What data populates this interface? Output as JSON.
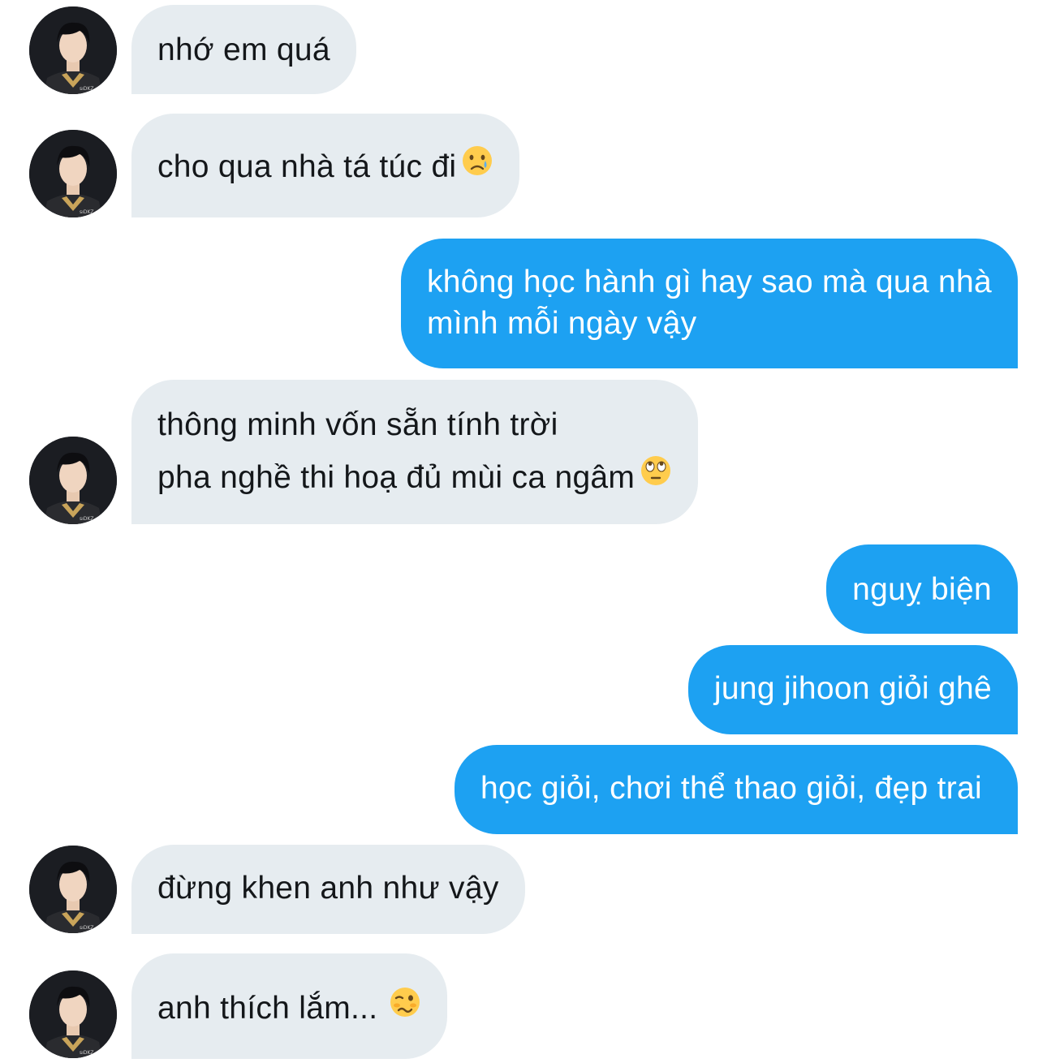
{
  "conversation": {
    "contact_avatar_label": "sıDKZ",
    "messages": [
      {
        "from": "them",
        "lines": [
          "nhớ em quá"
        ]
      },
      {
        "from": "them",
        "lines": [
          "cho qua nhà tá túc đi"
        ],
        "emoji": "crying-face"
      },
      {
        "from": "me",
        "lines": [
          "không học hành gì hay sao mà qua nhà",
          "mình mỗi ngày vậy"
        ]
      },
      {
        "from": "them",
        "lines": [
          "thông minh vốn sẵn tính trời",
          "pha nghề thi hoạ đủ mùi ca ngâm"
        ],
        "emoji": "eye-roll-face"
      },
      {
        "from": "me",
        "lines": [
          "nguỵ biện"
        ]
      },
      {
        "from": "me",
        "lines": [
          "jung jihoon giỏi ghê"
        ]
      },
      {
        "from": "me",
        "lines": [
          "học giỏi, chơi thể thao giỏi, đẹp trai"
        ]
      },
      {
        "from": "them",
        "lines": [
          "đừng khen anh như vậy"
        ]
      },
      {
        "from": "them",
        "lines": [
          "anh thích lắm..."
        ],
        "emoji": "woozy-face"
      }
    ]
  },
  "colors": {
    "incoming_bubble": "#e6ecf0",
    "outgoing_bubble": "#1da1f2",
    "incoming_text": "#14171a",
    "outgoing_text": "#ffffff"
  }
}
